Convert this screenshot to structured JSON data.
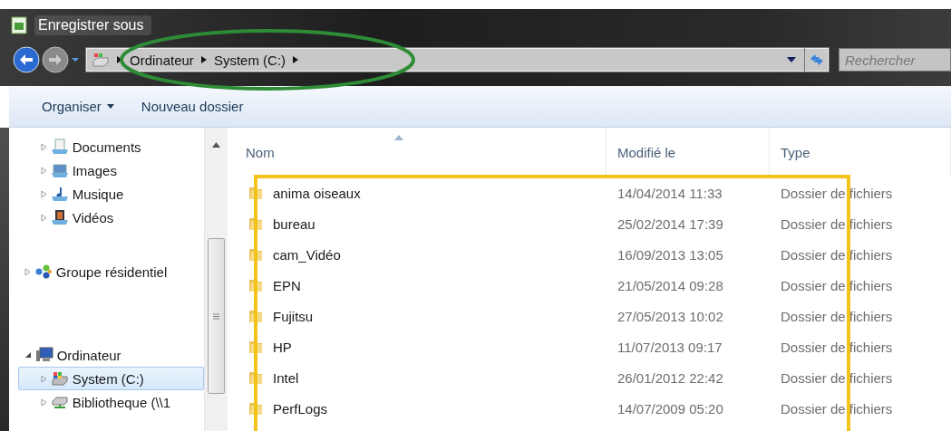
{
  "window": {
    "title": "Enregistrer sous"
  },
  "address": {
    "segments": [
      "Ordinateur",
      "System (C:)"
    ]
  },
  "search": {
    "placeholder": "Rechercher"
  },
  "toolbar": {
    "buttons": [
      {
        "label": "Organiser",
        "menu": true
      },
      {
        "label": "Nouveau dossier",
        "menu": false
      }
    ]
  },
  "sidebar": {
    "items": [
      {
        "kind": "continued",
        "children": [
          {
            "kind": "documents",
            "label": "Documents",
            "expanded": false,
            "selected": false
          },
          {
            "kind": "images",
            "label": "Images",
            "expanded": false,
            "selected": false
          },
          {
            "kind": "music",
            "label": "Musique",
            "expanded": false,
            "selected": false
          },
          {
            "kind": "videos",
            "label": "Vidéos",
            "expanded": false,
            "selected": false
          }
        ]
      },
      {
        "kind": "homegroup",
        "label": "Groupe résidentiel",
        "expanded": false,
        "selected": false
      },
      {
        "kind": "computer",
        "label": "Ordinateur",
        "expanded": true,
        "selected": false,
        "children": [
          {
            "kind": "drive",
            "label": "System (C:)",
            "expanded": false,
            "selected": true
          },
          {
            "kind": "netdrive",
            "label": "Bibliotheque (\\\\1",
            "expanded": false,
            "selected": false
          }
        ]
      }
    ]
  },
  "table": {
    "columns": [
      "Nom",
      "Modifié le",
      "Type"
    ],
    "rows": [
      {
        "name": "anima oiseaux",
        "modified": "14/04/2014 11:33",
        "type": "Dossier de fichiers"
      },
      {
        "name": "bureau",
        "modified": "25/02/2014 17:39",
        "type": "Dossier de fichiers"
      },
      {
        "name": "cam_Vidéo",
        "modified": "16/09/2013 13:05",
        "type": "Dossier de fichiers"
      },
      {
        "name": "EPN",
        "modified": "21/05/2014 09:28",
        "type": "Dossier de fichiers"
      },
      {
        "name": "Fujitsu",
        "modified": "27/05/2013 10:02",
        "type": "Dossier de fichiers"
      },
      {
        "name": "HP",
        "modified": "11/07/2013 09:17",
        "type": "Dossier de fichiers"
      },
      {
        "name": "Intel",
        "modified": "26/01/2012 22:42",
        "type": "Dossier de fichiers"
      },
      {
        "name": "PerfLogs",
        "modified": "14/07/2009 05:20",
        "type": "Dossier de fichiers"
      }
    ]
  },
  "annotations": [
    {
      "kind": "ellipse",
      "color": "#2e8b36"
    },
    {
      "kind": "rectangle",
      "color": "#f2c318"
    }
  ]
}
